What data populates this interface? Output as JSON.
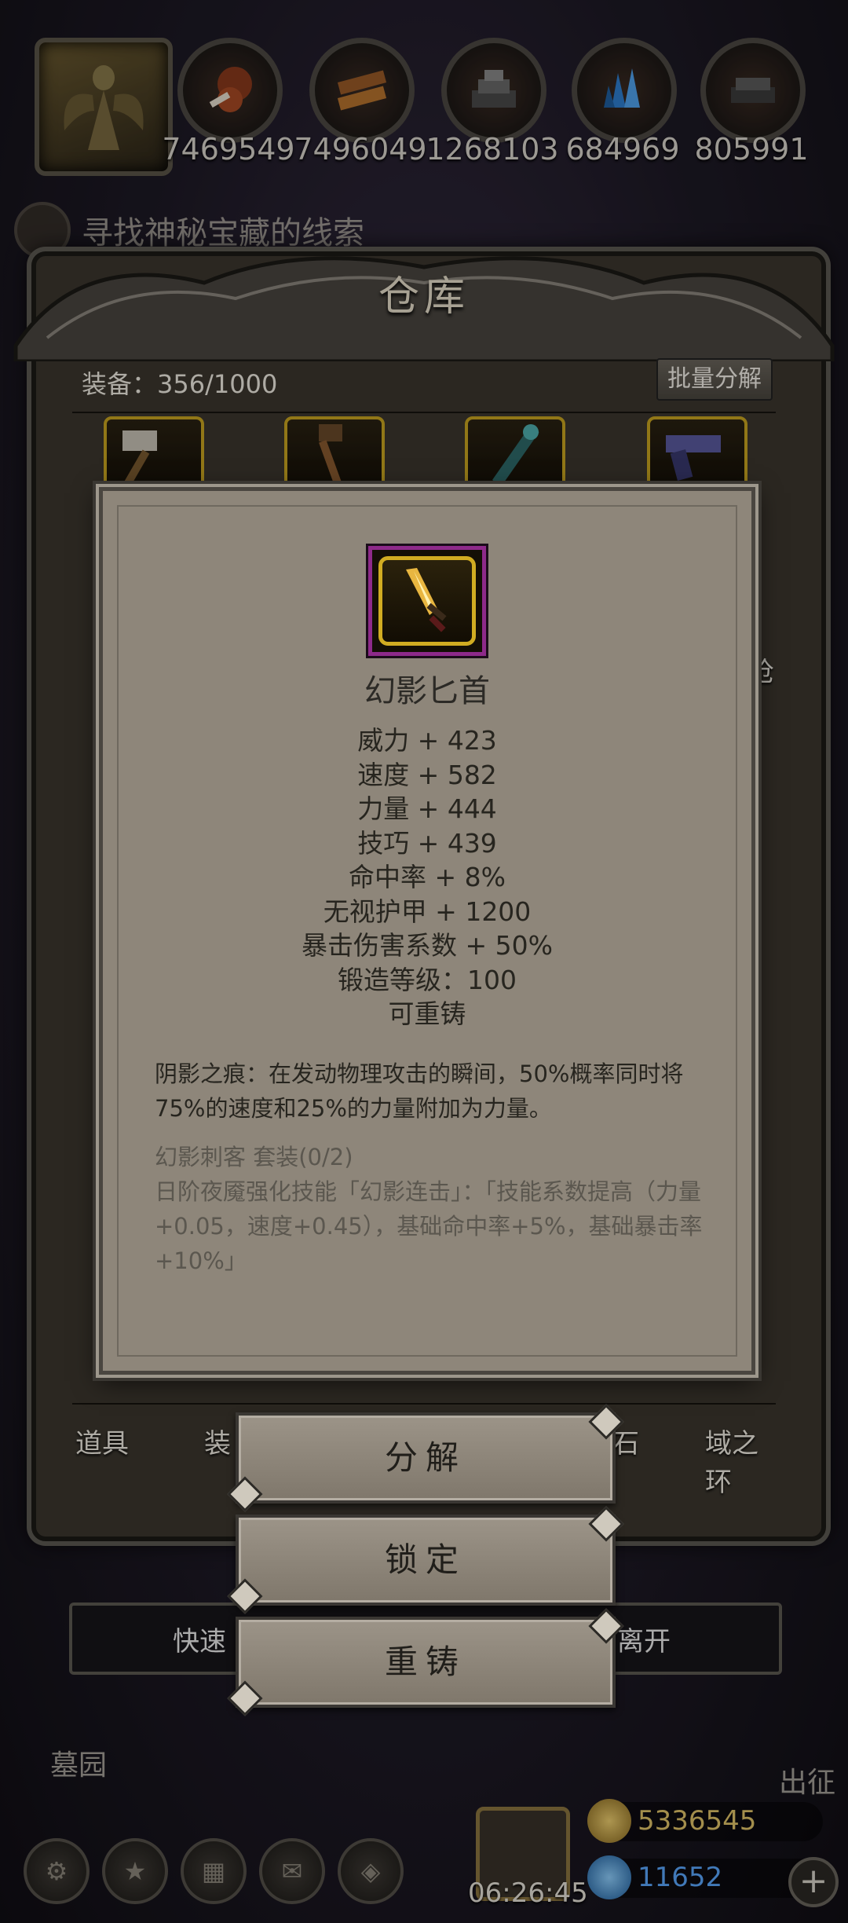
{
  "top_bar": {
    "resources": [
      {
        "icon": "meat-icon",
        "value": "7469549"
      },
      {
        "icon": "wood-icon",
        "value": "7496049"
      },
      {
        "icon": "stone-icon",
        "value": "1268103"
      },
      {
        "icon": "crystal-icon",
        "value": "684969"
      },
      {
        "icon": "iron-icon",
        "value": "805991"
      }
    ]
  },
  "quest": {
    "text": "寻找神秘宝藏的线索"
  },
  "warehouse": {
    "title": "仓库",
    "equip_count": "装备：356/1000",
    "batch_button": "批量分解",
    "side_right": "枪",
    "tabs": [
      "道具",
      "装",
      "石",
      "域之环"
    ],
    "quick_left": "快速",
    "quick_right": "离开"
  },
  "tooltip": {
    "item_name": "幻影匕首",
    "stats": [
      "威力 + 423",
      "速度 + 582",
      "力量 + 444",
      "技巧 + 439",
      "命中率 + 8%",
      "无视护甲 + 1200",
      "暴击伤害系数 + 50%",
      "锻造等级：100",
      "可重铸"
    ],
    "effect": "阴影之痕：在发动物理攻击的瞬间，50%概率同时将75%的速度和25%的力量附加为力量。",
    "set_title": "幻影刺客 套装(0/2)",
    "set_desc": "日阶夜魇强化技能「幻影连击」：「技能系数提高（力量+0.05，速度+0.45），基础命中率+5%，基础暴击率+10%」"
  },
  "actions": {
    "decompose": "分解",
    "lock": "锁定",
    "reforge": "重铸"
  },
  "bottom": {
    "left_label": "墓园",
    "right_label": "出征",
    "clock": "06:26:45",
    "gold": "5336545",
    "gems": "11652"
  },
  "colors": {
    "tooltip_bg": "#8e867a",
    "rarity_border": "#8e2a8a",
    "slot_border": "#c9a520",
    "gem_text": "#5aa8ff",
    "gold_text": "#e2c56a"
  }
}
